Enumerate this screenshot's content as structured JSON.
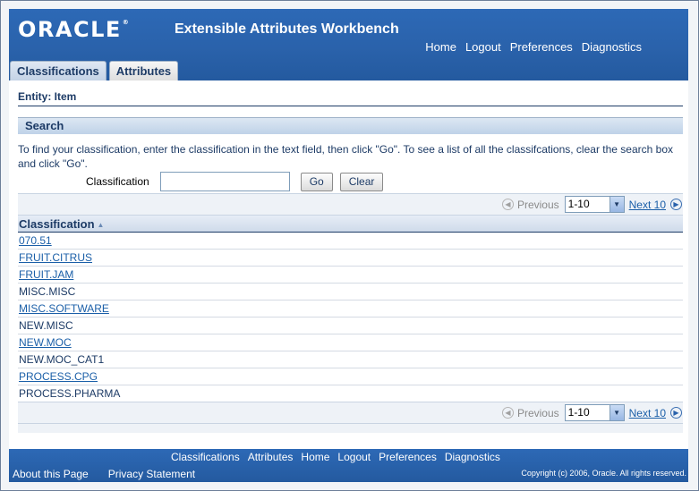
{
  "header": {
    "logo_text": "ORACLE",
    "logo_reg": "®",
    "app_title": "Extensible Attributes Workbench",
    "global_links": [
      "Home",
      "Logout",
      "Preferences",
      "Diagnostics"
    ]
  },
  "tabs": [
    {
      "label": "Classifications",
      "active": true
    },
    {
      "label": "Attributes",
      "active": false
    }
  ],
  "entity_label": "Entity: Item",
  "search": {
    "header": "Search",
    "instructions": "To find your classification, enter the classification in the text field, then click \"Go\". To see a list of all the classifcations, clear the search box and click \"Go\".",
    "field_label": "Classification",
    "field_value": "",
    "go_label": "Go",
    "clear_label": "Clear"
  },
  "pagination": {
    "previous_label": "Previous",
    "range_value": "1-10",
    "next_label": "Next 10"
  },
  "table": {
    "column_header": "Classification",
    "rows": [
      {
        "text": "070.51",
        "link": true
      },
      {
        "text": "FRUIT.CITRUS",
        "link": true
      },
      {
        "text": "FRUIT.JAM",
        "link": true
      },
      {
        "text": "MISC.MISC",
        "link": false
      },
      {
        "text": "MISC.SOFTWARE",
        "link": true
      },
      {
        "text": "NEW.MISC",
        "link": false
      },
      {
        "text": "NEW.MOC",
        "link": true
      },
      {
        "text": "NEW.MOC_CAT1",
        "link": false
      },
      {
        "text": "PROCESS.CPG",
        "link": true
      },
      {
        "text": "PROCESS.PHARMA",
        "link": false
      }
    ]
  },
  "footer": {
    "links": [
      "Classifications",
      "Attributes",
      "Home",
      "Logout",
      "Preferences",
      "Diagnostics"
    ],
    "about": "About this Page",
    "privacy": "Privacy Statement",
    "copyright": "Copyright (c) 2006, Oracle. All rights reserved."
  },
  "colors": {
    "brand_blue": "#2a62ab",
    "link_blue": "#1b5fa8",
    "heading_navy": "#1d3b66"
  },
  "icons": {
    "previous": "circle-left-arrow-icon",
    "next": "circle-right-arrow-icon",
    "sort": "sort-ascending-icon",
    "dropdown": "chevron-down-icon"
  }
}
